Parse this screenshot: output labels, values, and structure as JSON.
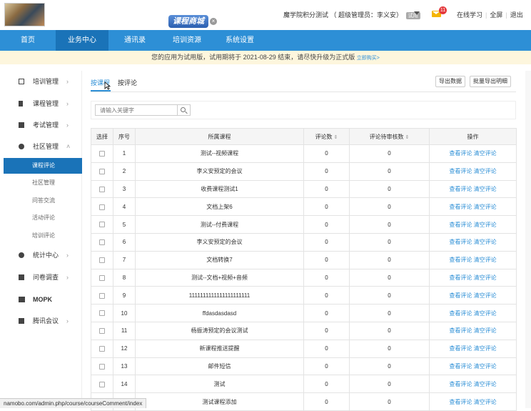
{
  "header": {
    "mall_badge": "课程商城",
    "school_name": "魔学院积分测试",
    "admin_text": "（ 超级管理员：李义安）",
    "trial_tag": "试用",
    "mail_count": "11",
    "links": [
      "在线学习",
      "全屏",
      "退出"
    ]
  },
  "nav": {
    "items": [
      "首页",
      "业务中心",
      "通讯录",
      "培训资源",
      "系统设置"
    ],
    "active": "业务中心"
  },
  "notice": {
    "text": "您的应用为试用版，试用期将于 2021-08-29 结束，请尽快升级为正式版",
    "link": "立即购买>"
  },
  "sidebar": {
    "items": [
      {
        "label": "培训管理",
        "icon": "grid-icon"
      },
      {
        "label": "课程管理",
        "icon": "flag-icon"
      },
      {
        "label": "考试管理",
        "icon": "document-icon"
      },
      {
        "label": "社区管理",
        "icon": "users-icon"
      }
    ],
    "community_subitems": [
      "课程评论",
      "社区管理",
      "问答交流",
      "活动评论",
      "培训评论"
    ],
    "active_sub": "课程评论",
    "items_after": [
      {
        "label": "统计中心",
        "icon": "pie-chart-icon"
      },
      {
        "label": "问卷调查",
        "icon": "survey-icon"
      },
      {
        "label": "MOPK",
        "icon": "pk-icon"
      },
      {
        "label": "腾讯会议",
        "icon": "meeting-icon"
      }
    ]
  },
  "tabs": [
    {
      "label": "按课程",
      "active": true
    },
    {
      "label": "按评论",
      "active": false
    }
  ],
  "buttons": {
    "export": "导出数据",
    "batch_export": "批量导出明细"
  },
  "search": {
    "placeholder": "请输入关键字"
  },
  "table": {
    "headers": [
      "选择",
      "序号",
      "所属课程",
      "评论数",
      "评论待审核数",
      "操作"
    ],
    "rows": [
      [
        "1",
        "测试--视频课程",
        "0",
        "0"
      ],
      [
        "2",
        "李义安预定的会议",
        "0",
        "0"
      ],
      [
        "3",
        "收费课程测试1",
        "0",
        "0"
      ],
      [
        "4",
        "文档上架6",
        "0",
        "0"
      ],
      [
        "5",
        "测试--付费课程",
        "0",
        "0"
      ],
      [
        "6",
        "李义安预定的会议",
        "0",
        "0"
      ],
      [
        "7",
        "文档转换7",
        "0",
        "0"
      ],
      [
        "8",
        "测试--文档+视频+音频",
        "0",
        "0"
      ],
      [
        "9",
        "1111111111111111111111",
        "0",
        "0"
      ],
      [
        "10",
        "ffdasdasdasd",
        "0",
        "0"
      ],
      [
        "11",
        "杨振涛预定的会议测试",
        "0",
        "0"
      ],
      [
        "12",
        "新课程推送提醒",
        "0",
        "0"
      ],
      [
        "13",
        "邮件短信",
        "0",
        "0"
      ],
      [
        "14",
        "测试",
        "0",
        "0"
      ],
      [
        "15",
        "测试课程添加",
        "0",
        "0"
      ]
    ],
    "ops_view": "查看评论",
    "ops_clear": "清空评论"
  },
  "statusbar": {
    "url": "namobo.com/admin.php/course/courseComment/index"
  }
}
